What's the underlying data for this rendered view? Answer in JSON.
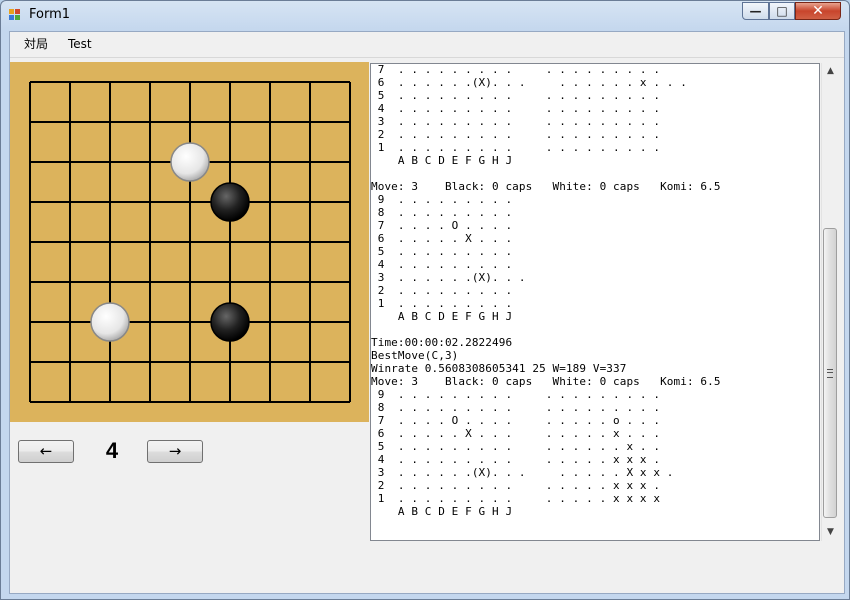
{
  "window": {
    "title": "Form1"
  },
  "menu": {
    "items": [
      "対局",
      "Test"
    ]
  },
  "board": {
    "size": 9,
    "stones": [
      {
        "col": "E",
        "row": 7,
        "color": "white"
      },
      {
        "col": "F",
        "row": 6,
        "color": "black"
      },
      {
        "col": "C",
        "row": 3,
        "color": "white"
      },
      {
        "col": "F",
        "row": 3,
        "color": "black"
      }
    ]
  },
  "navigation": {
    "prev_label": "←",
    "next_label": "→",
    "move_number": "4"
  },
  "log": {
    "lines": [
      " 7  . . . . . . . . .     . . . . . . . . .",
      " 6  . . . . . .(X). . .     . . . . . . x . . .",
      " 5  . . . . . . . . .     . . . . . . . . .",
      " 4  . . . . . . . . .     . . . . . . . . .",
      " 3  . . . . . . . . .     . . . . . . . . .",
      " 2  . . . . . . . . .     . . . . . . . . .",
      " 1  . . . . . . . . .     . . . . . . . . .",
      "    A B C D E F G H J",
      "",
      "Move: 3    Black: 0 caps   White: 0 caps   Komi: 6.5",
      " 9  . . . . . . . . .",
      " 8  . . . . . . . . .",
      " 7  . . . . O . . . .",
      " 6  . . . . . X . . .",
      " 5  . . . . . . . . .",
      " 4  . . . . . . . . .",
      " 3  . . . . . .(X). . .",
      " 2  . . . . . . . . .",
      " 1  . . . . . . . . .",
      "    A B C D E F G H J",
      "",
      "Time:00:00:02.2822496",
      "BestMove(C,3)",
      "Winrate 0.5608308605341 25 W=189 V=337",
      "Move: 3    Black: 0 caps   White: 0 caps   Komi: 6.5",
      " 9  . . . . . . . . .     . . . . . . . . .",
      " 8  . . . . . . . . .     . . . . . . . . .",
      " 7  . . . . O . . . .     . . . . . o . . .",
      " 6  . . . . . X . . .     . . . . . x . . .",
      " 5  . . . . . . . . .     . . . . . . x . .",
      " 4  . . . . . . . . .     . . . . . x x x .",
      " 3  . . . . . .(X). . .     . . . . . X x x .",
      " 2  . . . . . . . . .     . . . . . x x x .",
      " 1  . . . . . . . . .     . . . . . x x x x",
      "    A B C D E F G H J"
    ]
  },
  "colors": {
    "board": "#dcb35c",
    "grid": "#000000"
  }
}
